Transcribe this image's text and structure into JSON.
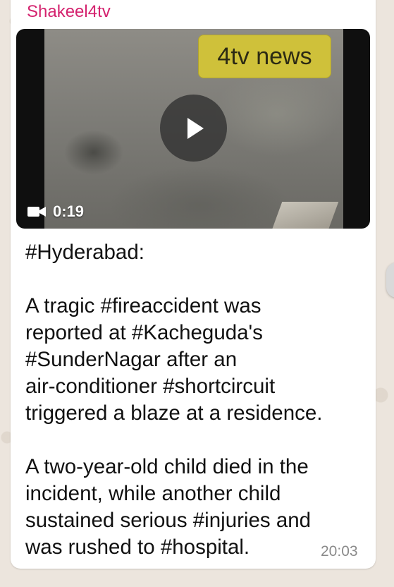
{
  "chat": {
    "sender": "Shakeel4tv",
    "video": {
      "badge": "4tv news",
      "duration": "0:19"
    },
    "message": "#Hyderabad:\n\nA tragic #fireaccident was\nreported at #Kacheguda's\n#SunderNagar after an\nair-conditioner #shortcircuit\ntriggered a blaze at a residence.\n\nA two-year-old child died in the\nincident, while another child\nsustained serious #injuries and\nwas rushed to #hospital.",
    "time": "20:03"
  },
  "colors": {
    "sender": "#d4226e",
    "background": "#ece5dd",
    "bubble": "#ffffff",
    "badge": "#cfc13a"
  },
  "icons": {
    "play": "play-icon",
    "video": "video-camera-icon"
  }
}
